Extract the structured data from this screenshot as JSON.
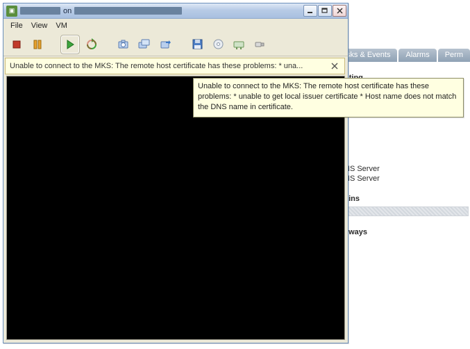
{
  "host": {
    "tabs": [
      "Tasks & Events",
      "Alarms",
      "Perm"
    ],
    "section_routing": "uting",
    "dns1": "NS Server",
    "dns2": "NS Server",
    "section_domains": "ains",
    "section_gateways": "eways"
  },
  "console": {
    "title_on": "on",
    "menus": [
      "File",
      "View",
      "VM"
    ],
    "toolbar_icons": {
      "stop": "stop-icon",
      "pause": "pause-icon",
      "play": "play-icon",
      "cycle": "cycle-icon",
      "snapshot": "snapshot-icon",
      "snapshot_mgr": "snapshot-manager-icon",
      "revert": "revert-icon",
      "floppy": "floppy-icon",
      "cd": "cd-icon",
      "network": "network-icon",
      "usb": "usb-icon"
    },
    "alert_short": "Unable to connect to the MKS: The remote host certificate has these problems:  * una...",
    "alert_full": "Unable to connect to the MKS: The remote host certificate has these problems:  * unable to get local issuer certificate  * Host name does not match the DNS name in certificate.",
    "win_buttons": {
      "min": "_",
      "max": "❐",
      "close": "✕"
    }
  }
}
